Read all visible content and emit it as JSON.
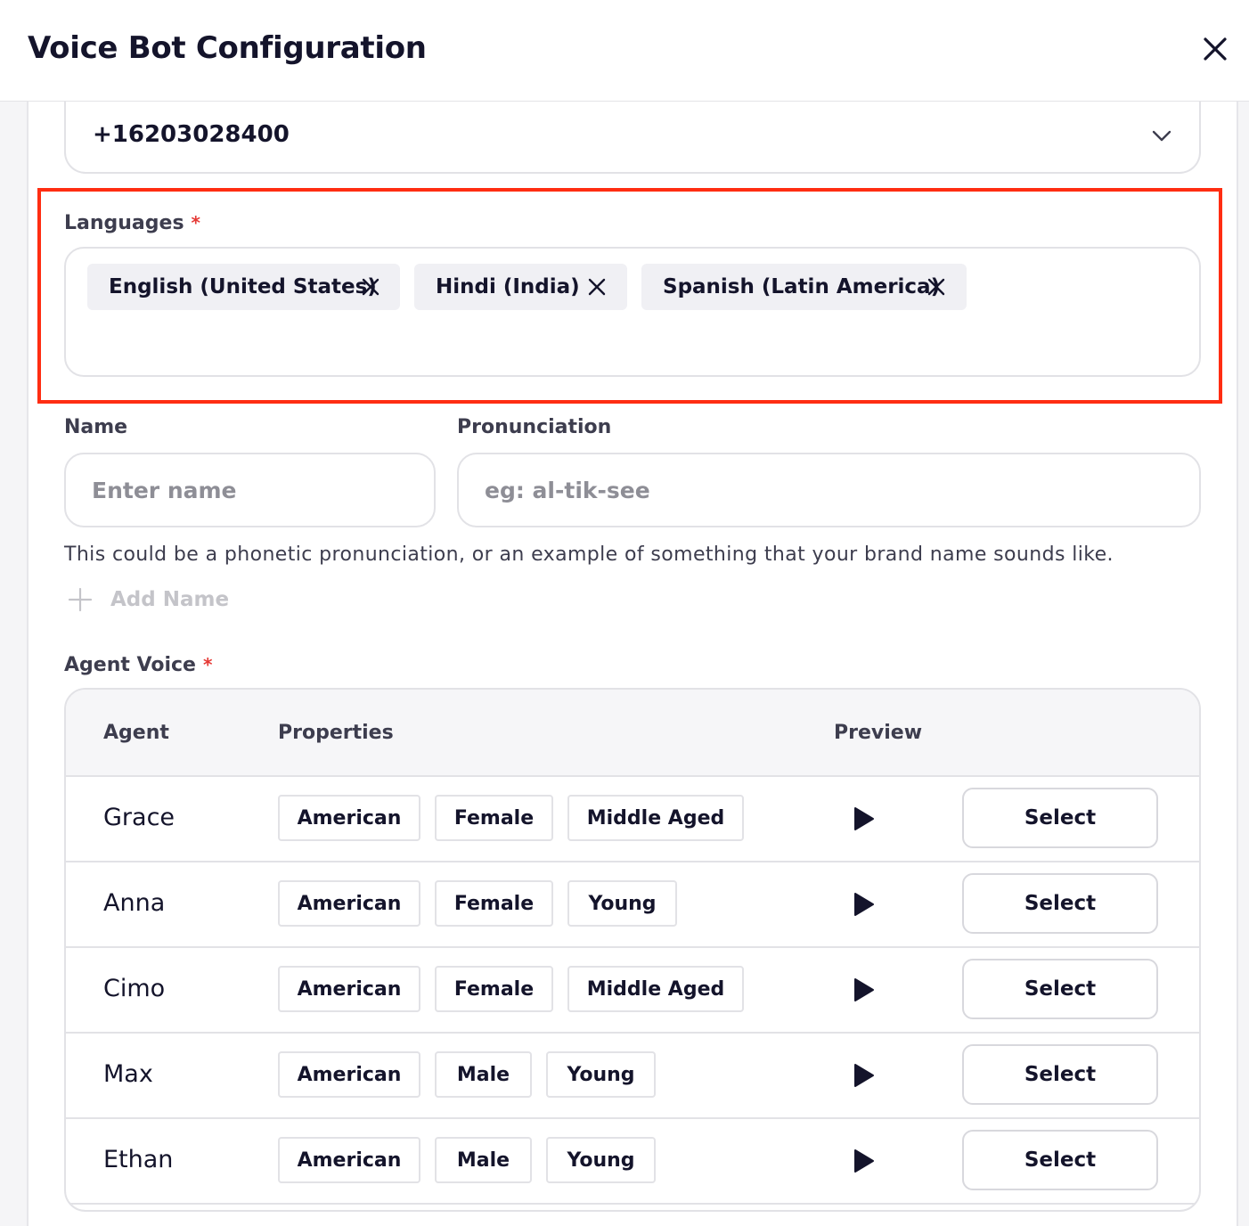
{
  "header": {
    "title": "Voice Bot Configuration"
  },
  "phone": {
    "value": "+16203028400"
  },
  "languages": {
    "label": "Languages",
    "required_mark": "*",
    "chips": [
      {
        "label": "English (United States)"
      },
      {
        "label": "Hindi (India)"
      },
      {
        "label": "Spanish (Latin America)"
      }
    ]
  },
  "name_field": {
    "label": "Name",
    "placeholder": "Enter name",
    "value": ""
  },
  "pronunciation_field": {
    "label": "Pronunciation",
    "placeholder": "eg: al-tik-see",
    "value": ""
  },
  "helper_text": "This could be a phonetic pronunciation, or an example of something that your brand name sounds like.",
  "add_name_label": "Add Name",
  "agent_voice": {
    "label": "Agent Voice",
    "required_mark": "*",
    "columns": {
      "agent": "Agent",
      "properties": "Properties",
      "preview": "Preview"
    },
    "rows": [
      {
        "name": "Grace",
        "props": [
          "American",
          "Female",
          "Middle Aged"
        ],
        "select_label": "Select"
      },
      {
        "name": "Anna",
        "props": [
          "American",
          "Female",
          "Young"
        ],
        "select_label": "Select"
      },
      {
        "name": "Cimo",
        "props": [
          "American",
          "Female",
          "Middle Aged"
        ],
        "select_label": "Select"
      },
      {
        "name": "Max",
        "props": [
          "American",
          "Male",
          "Young"
        ],
        "select_label": "Select"
      },
      {
        "name": "Ethan",
        "props": [
          "American",
          "Male",
          "Young"
        ],
        "select_label": "Select"
      }
    ]
  },
  "colors": {
    "accent_highlight": "#ff2d12",
    "required": "#e53935",
    "text": "#14142b",
    "muted": "#c4c4c9"
  }
}
